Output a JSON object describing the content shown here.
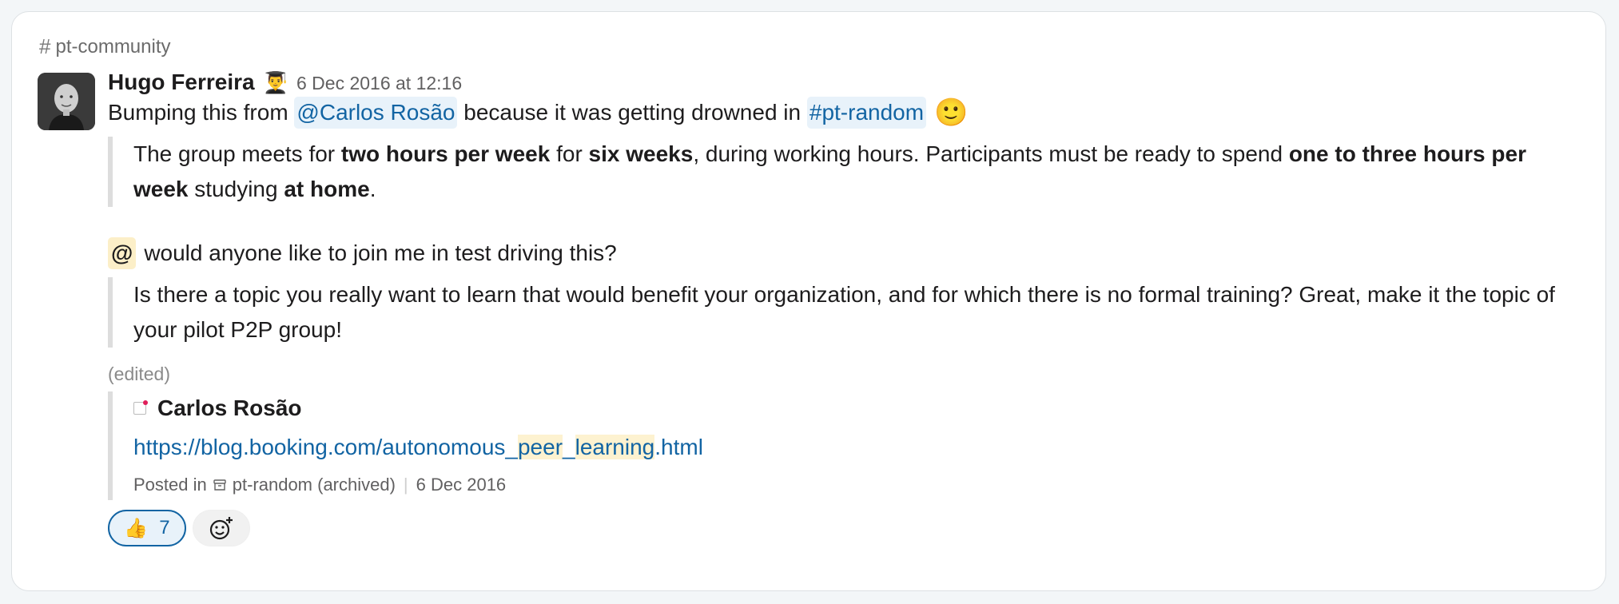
{
  "channel": {
    "name": "pt-community"
  },
  "message": {
    "author": "Hugo Ferreira",
    "status_emoji": "👨‍🎓",
    "timestamp": "6 Dec 2016 at 12:16",
    "intro_prefix": "Bumping this from ",
    "intro_mention": "@Carlos Rosão",
    "intro_middle": " because it was getting drowned in ",
    "intro_channel": "#pt-random",
    "intro_emoji": "🙂",
    "quote1": {
      "p1": "The group meets for ",
      "b1": "two hours per week",
      "p2": " for ",
      "b2": "six weeks",
      "p3": ", during working hours. Participants must be ready to spend ",
      "b3": "one to three hours per week",
      "p4": " studying ",
      "b4": "at home",
      "p5": "."
    },
    "at_chip": "@",
    "question": "would anyone like to join me in test driving this?",
    "quote2": "Is there a topic you really want to learn that would benefit your organization, and for which there is no formal training? Great, make it the topic of your pilot P2P group!",
    "edited": "(edited)"
  },
  "attachment": {
    "author": "Carlos Rosão",
    "link_p1": "https://blog.booking.com/autonomous_",
    "link_hl1": "peer",
    "link_p2": "_",
    "link_hl2": "learning",
    "link_p3": ".html",
    "posted_in_label": "Posted in",
    "posted_channel": "pt-random (archived)",
    "posted_date": "6 Dec 2016"
  },
  "reactions": [
    {
      "emoji": "👍",
      "count": "7",
      "active": true
    }
  ],
  "colors": {
    "link": "#1264a3",
    "mention_bg": "#e8f2fa",
    "highlight": "#fdf2d0"
  }
}
